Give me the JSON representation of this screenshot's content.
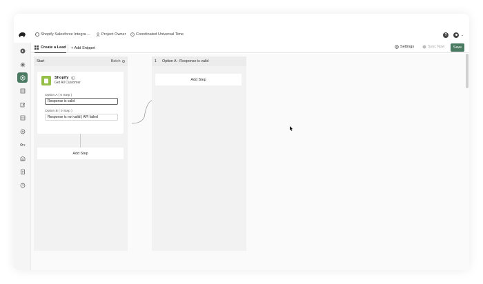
{
  "topbar": {
    "project_name": "Shopify Salesforce Integra ...",
    "owner": "Project Owner",
    "timezone": "Coordinated Universal Time",
    "help_label": "?"
  },
  "sidebar": {
    "items": [
      {
        "icon": "back-arrow-icon"
      },
      {
        "icon": "sparkle-icon"
      },
      {
        "icon": "flow-icon",
        "active": true
      },
      {
        "icon": "database-icon"
      },
      {
        "icon": "edit-icon"
      },
      {
        "icon": "table-icon"
      },
      {
        "icon": "globe-icon"
      },
      {
        "icon": "key-icon"
      },
      {
        "icon": "building-icon"
      },
      {
        "icon": "clipboard-icon"
      },
      {
        "icon": "clock-icon"
      }
    ]
  },
  "toolbar": {
    "tab_active": "Create a Lead",
    "tab_add_snippet": "+ Add Snippet",
    "settings_label": "Settings",
    "sync_label": "Sync Now",
    "save_label": "Save"
  },
  "column1": {
    "header_left": "Start",
    "header_right": "Batch",
    "card": {
      "title": "Shopify",
      "badge": "1",
      "subtitle": "Get All Customer"
    },
    "option_a": {
      "label": "Option A ( 0 Step )",
      "value": "Response is valid"
    },
    "option_b": {
      "label": "Option B ( 0 Step )",
      "value": "Response is not valid | API failed"
    },
    "add_step": "Add Step"
  },
  "column2": {
    "index": "1",
    "header": "Option A - Response is valid",
    "add_step": "Add Step"
  },
  "colors": {
    "accent": "#4a7a62",
    "shopify": "#95bf47"
  }
}
